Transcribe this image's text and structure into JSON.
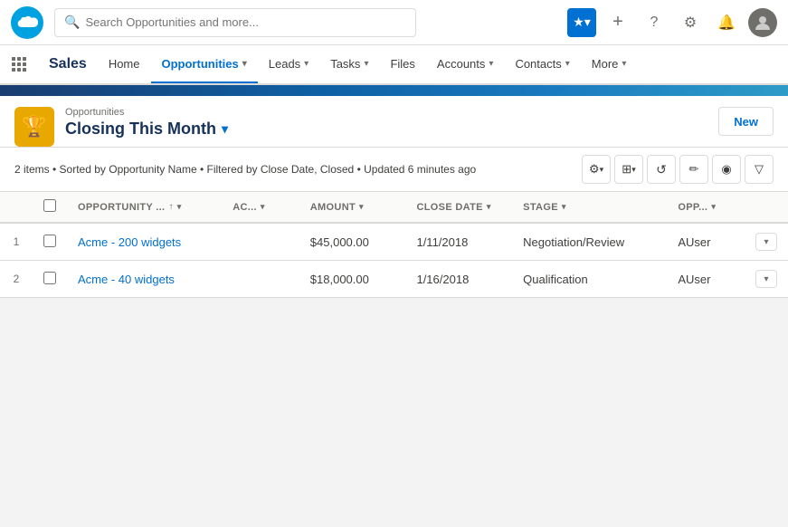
{
  "app": {
    "name": "Sales",
    "search_placeholder": "Search Opportunities and more..."
  },
  "nav": {
    "items": [
      {
        "label": "Home",
        "active": false
      },
      {
        "label": "Opportunities",
        "active": true,
        "has_chevron": true
      },
      {
        "label": "Leads",
        "active": false,
        "has_chevron": true
      },
      {
        "label": "Tasks",
        "active": false,
        "has_chevron": true
      },
      {
        "label": "Files",
        "active": false,
        "has_chevron": false
      },
      {
        "label": "Accounts",
        "active": false,
        "has_chevron": true
      },
      {
        "label": "Contacts",
        "active": false,
        "has_chevron": true
      },
      {
        "label": "More",
        "active": false,
        "has_chevron": true
      }
    ]
  },
  "list_view": {
    "breadcrumb": "Opportunities",
    "title": "Closing This Month",
    "new_button": "New",
    "info_text": "2 items • Sorted by Opportunity Name • Filtered by Close Date, Closed • Updated 6 minutes ago"
  },
  "table": {
    "columns": [
      {
        "label": "OPPORTUNITY ...",
        "sortable": true,
        "has_chevron": true
      },
      {
        "label": "AC...",
        "sortable": false,
        "has_chevron": true
      },
      {
        "label": "AMOUNT",
        "sortable": false,
        "has_chevron": true
      },
      {
        "label": "CLOSE DATE",
        "sortable": false,
        "has_chevron": true
      },
      {
        "label": "STAGE",
        "sortable": false,
        "has_chevron": true
      },
      {
        "label": "OPP...",
        "sortable": false,
        "has_chevron": true
      }
    ],
    "rows": [
      {
        "num": "1",
        "opportunity": "Acme - 200 widgets",
        "account": "",
        "amount": "$45,000.00",
        "close_date": "1/11/2018",
        "stage": "Negotiation/Review",
        "owner": "AUser"
      },
      {
        "num": "2",
        "opportunity": "Acme - 40 widgets",
        "account": "",
        "amount": "$18,000.00",
        "close_date": "1/16/2018",
        "stage": "Qualification",
        "owner": "AUser"
      }
    ]
  },
  "icons": {
    "grid": "⋮⋮",
    "search": "🔍",
    "star": "★",
    "plus": "+",
    "question": "?",
    "gear": "⚙",
    "bell": "🔔",
    "trophy": "🏆",
    "chevron_down": "▾",
    "chevron_up": "↑",
    "sort_asc": "↑",
    "refresh": "↺",
    "pencil": "✏",
    "chart": "◉",
    "filter": "▽",
    "table_view": "⊞",
    "gear_small": "⚙"
  }
}
